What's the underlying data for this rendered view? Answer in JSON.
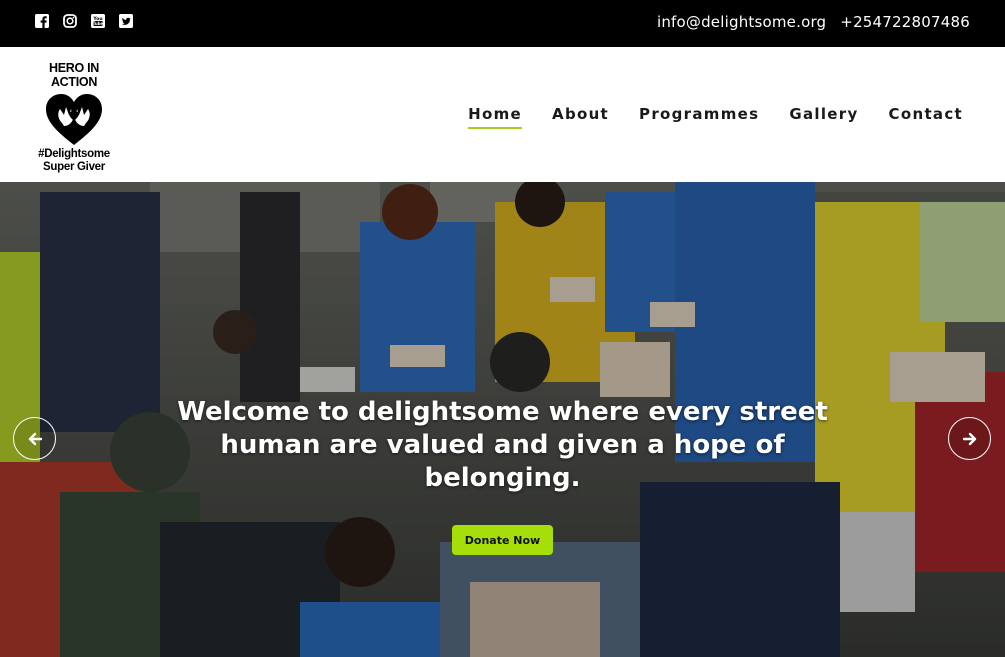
{
  "topbar": {
    "social_icons": [
      "facebook-icon",
      "instagram-icon",
      "youtube-icon",
      "twitter-icon"
    ],
    "email": "info@delightsome.org",
    "phone": "+254722807486"
  },
  "logo": {
    "top_text": "HERO IN ACTION",
    "bottom_line1": "#Delightsome",
    "bottom_line2": "Super Giver"
  },
  "nav": {
    "items": [
      {
        "label": "Home",
        "active": true
      },
      {
        "label": "About",
        "active": false
      },
      {
        "label": "Programmes",
        "active": false
      },
      {
        "label": "Gallery",
        "active": false
      },
      {
        "label": "Contact",
        "active": false
      }
    ]
  },
  "hero": {
    "headline": "Welcome to delightsome where every street human are valued and given a hope of belonging.",
    "cta_label": "Donate Now",
    "prev_icon": "arrow-left-icon",
    "next_icon": "arrow-right-icon"
  },
  "colors": {
    "accent": "#a6de0a",
    "nav_underline": "#a6cc1f",
    "topbar_bg": "#000000"
  }
}
